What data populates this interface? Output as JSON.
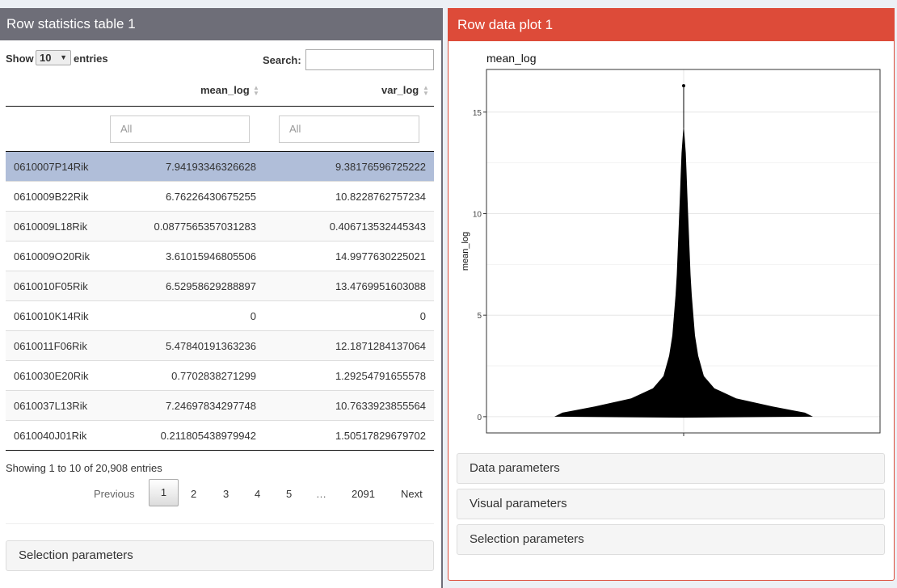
{
  "left_panel": {
    "title": "Row statistics table 1",
    "show_label": "Show",
    "entries_select": "10",
    "entries_label": "entries",
    "search_label": "Search:",
    "search_value": "",
    "columns": [
      "mean_log",
      "var_log"
    ],
    "filter_placeholder": "All",
    "rows": [
      {
        "name": "0610007P14Rik",
        "mean_log": "7.94193346326628",
        "var_log": "9.38176596725222"
      },
      {
        "name": "0610009B22Rik",
        "mean_log": "6.76226430675255",
        "var_log": "10.8228762757234"
      },
      {
        "name": "0610009L18Rik",
        "mean_log": "0.0877565357031283",
        "var_log": "0.406713532445343"
      },
      {
        "name": "0610009O20Rik",
        "mean_log": "3.61015946805506",
        "var_log": "14.9977630225021"
      },
      {
        "name": "0610010F05Rik",
        "mean_log": "6.52958629288897",
        "var_log": "13.4769951603088"
      },
      {
        "name": "0610010K14Rik",
        "mean_log": "0",
        "var_log": "0"
      },
      {
        "name": "0610011F06Rik",
        "mean_log": "5.47840191363236",
        "var_log": "12.1871284137064"
      },
      {
        "name": "0610030E20Rik",
        "mean_log": "0.7702838271299",
        "var_log": "1.29254791655578"
      },
      {
        "name": "0610037L13Rik",
        "mean_log": "7.24697834297748",
        "var_log": "10.7633923855564"
      },
      {
        "name": "0610040J01Rik",
        "mean_log": "0.211805438979942",
        "var_log": "1.50517829679702"
      }
    ],
    "info": "Showing 1 to 10 of 20,908 entries",
    "pagination": {
      "previous": "Previous",
      "pages": [
        "1",
        "2",
        "3",
        "4",
        "5",
        "…",
        "2091"
      ],
      "current": "1",
      "next": "Next"
    },
    "selection_parameters": "Selection parameters"
  },
  "right_panel": {
    "title": "Row data plot 1",
    "data_parameters": "Data parameters",
    "visual_parameters": "Visual parameters",
    "selection_parameters": "Selection parameters"
  },
  "colors": {
    "left_header": "#6e6e78",
    "right_header": "#dd4b39",
    "selected_row": "#b0bed9"
  },
  "chart_data": {
    "type": "violin",
    "title": "mean_log",
    "ylabel": "mean_log",
    "xlabel": "",
    "yticks": [
      0,
      5,
      10,
      15
    ],
    "ylim": [
      -0.8,
      17.1
    ],
    "max_value": 16.3,
    "grid": true,
    "color": "#000000"
  }
}
